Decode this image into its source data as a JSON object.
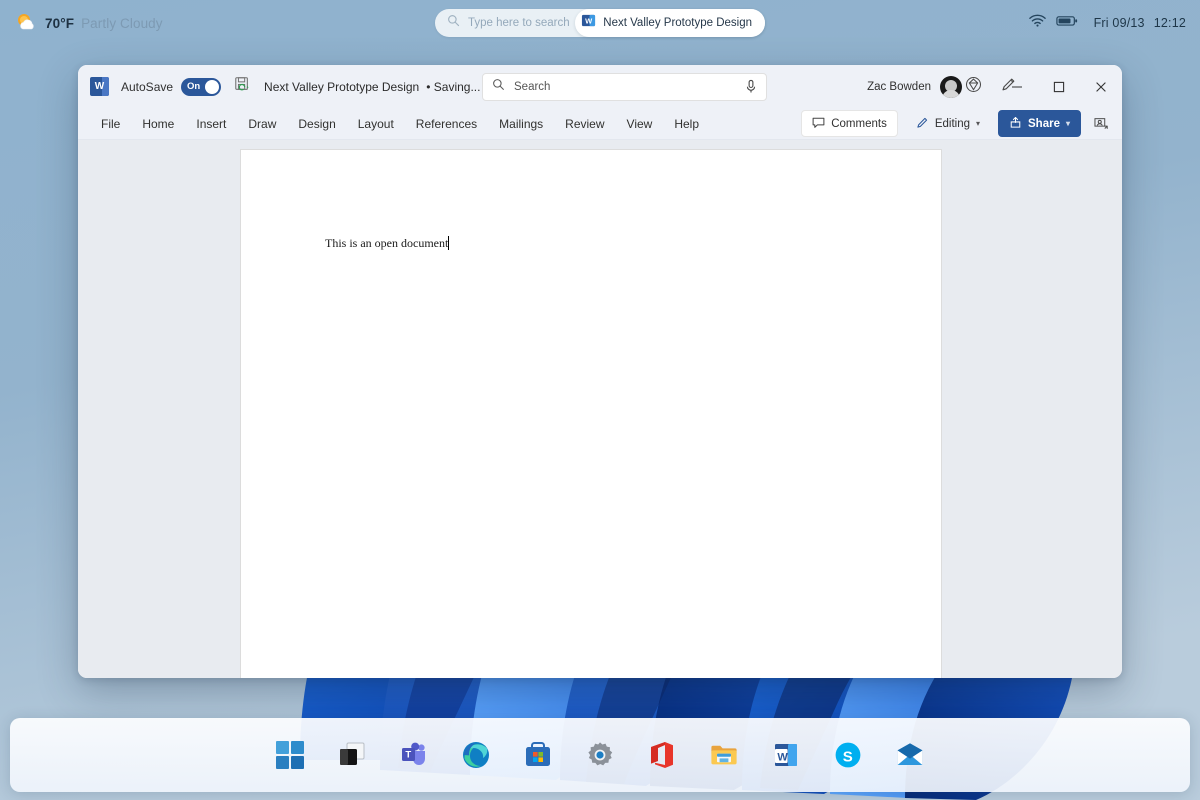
{
  "os": {
    "weather": {
      "icon": "sun-cloud-icon",
      "temperature": "70°F",
      "condition": "Partly Cloudy"
    },
    "taskbar_search": {
      "icon": "search-icon",
      "placeholder": "Type here to search",
      "suggestion_pill": {
        "icon": "word-icon",
        "label": "Next Valley Prototype Design"
      }
    },
    "tray": {
      "wifi_icon": "wifi-icon",
      "battery_icon": "battery-icon",
      "date": "Fri 09/13",
      "time": "12:12"
    },
    "taskbar_items": [
      {
        "name": "start-button",
        "label": "Start"
      },
      {
        "name": "task-view-button",
        "label": "Task View"
      },
      {
        "name": "teams-button",
        "label": "Microsoft Teams"
      },
      {
        "name": "edge-button",
        "label": "Microsoft Edge"
      },
      {
        "name": "store-button",
        "label": "Microsoft Store"
      },
      {
        "name": "settings-button",
        "label": "Settings"
      },
      {
        "name": "office-button",
        "label": "Office"
      },
      {
        "name": "file-explorer-button",
        "label": "File Explorer"
      },
      {
        "name": "word-button",
        "label": "Word"
      },
      {
        "name": "skype-button",
        "label": "Skype"
      },
      {
        "name": "mail-button",
        "label": "Mail"
      }
    ]
  },
  "word": {
    "app_icon": "word-icon",
    "app_letter": "W",
    "autosave": {
      "label": "AutoSave",
      "state": "On"
    },
    "save_icon": "save-refresh-icon",
    "document": {
      "title": "Next Valley Prototype Design",
      "status": "• Saving...",
      "chevron": "chevron-down-icon",
      "body_text": "This is an open document"
    },
    "search": {
      "icon": "search-icon",
      "placeholder": "Search",
      "mic_icon": "microphone-icon"
    },
    "user": {
      "name": "Zac Bowden",
      "avatar": "avatar"
    },
    "title_icons": [
      {
        "name": "diamond-icon"
      },
      {
        "name": "pen-draw-icon"
      }
    ],
    "window_controls": [
      {
        "name": "minimize-button",
        "glyph": "—"
      },
      {
        "name": "maximize-button",
        "glyph": "▢"
      },
      {
        "name": "close-button",
        "glyph": "✕"
      }
    ],
    "tabs": [
      {
        "label": "File"
      },
      {
        "label": "Home"
      },
      {
        "label": "Insert"
      },
      {
        "label": "Draw"
      },
      {
        "label": "Design"
      },
      {
        "label": "Layout"
      },
      {
        "label": "References"
      },
      {
        "label": "Mailings"
      },
      {
        "label": "Review"
      },
      {
        "label": "View"
      },
      {
        "label": "Help"
      }
    ],
    "ribbon_actions": {
      "comments": {
        "label": "Comments",
        "icon": "comment-bubble-icon"
      },
      "editing": {
        "label": "Editing",
        "icon": "pencil-icon",
        "chevron": "▾"
      },
      "share": {
        "label": "Share",
        "icon": "share-icon",
        "chevron": "▾"
      },
      "ribbon_display": {
        "icon": "ribbon-display-icon"
      }
    }
  },
  "colors": {
    "word_blue": "#2b579a",
    "desktop_blue": "#8fb0cc",
    "canvas_gray": "#e8ebf0",
    "titlebar": "#eef1f7"
  }
}
